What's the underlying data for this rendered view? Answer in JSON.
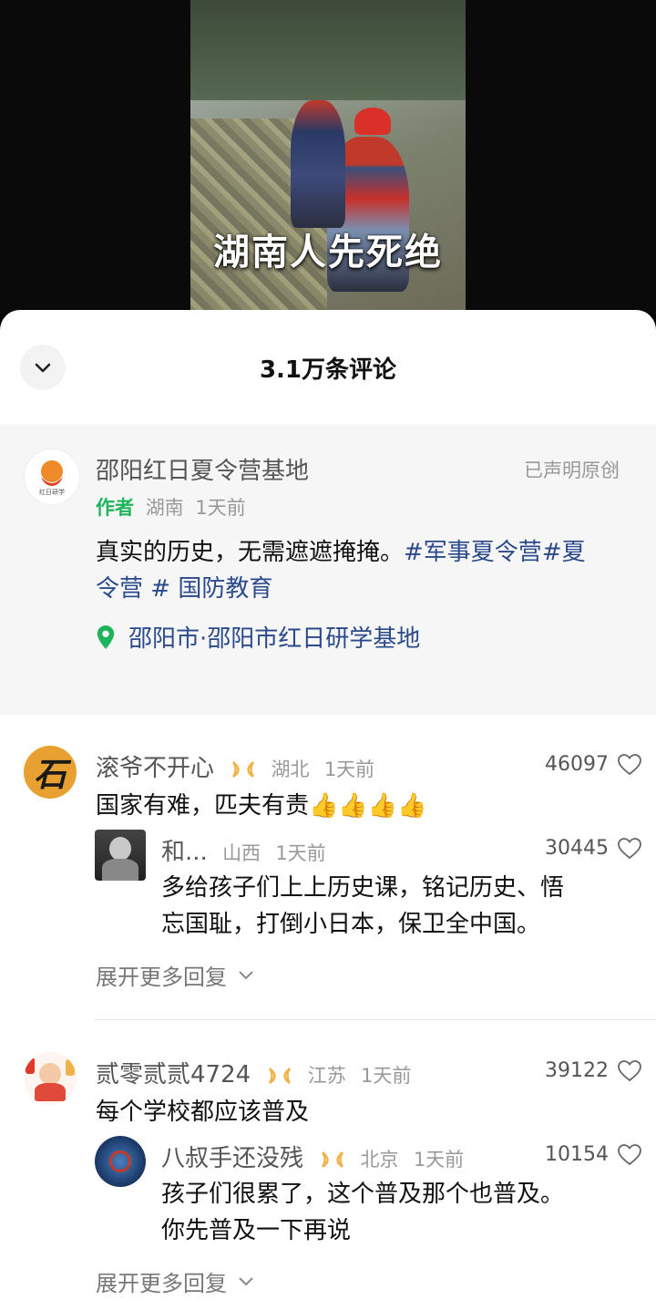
{
  "video": {
    "caption": "湖南人先死绝"
  },
  "sheet": {
    "title": "3.1万条评论"
  },
  "post": {
    "author": "邵阳红日夏令营基地",
    "avatar_text": "红日研学",
    "declare": "已声明原创",
    "author_tag": "作者",
    "region": "湖南",
    "time": "1天前",
    "text": "真实的历史，无需遮遮掩掩。",
    "hashtag1": "#军事夏令营",
    "hashtag2a": "#夏",
    "hashtag2b": "令营",
    "hashtag3": "# 国防教育",
    "location": "邵阳市·邵阳市红日研学基地",
    "location_color": "#1fb35b"
  },
  "comments": [
    {
      "name": "滚爷不开心",
      "avatar_text": "石",
      "region": "湖北",
      "time": "1天前",
      "likes": "46097",
      "text": "国家有难，匹夫有责",
      "emoji": "👍👍👍👍",
      "reply": {
        "name": "和...",
        "region": "山西",
        "time": "1天前",
        "likes": "30445",
        "text_line1": "多给孩子们上上历史课，铭记历史、悟",
        "text_line2": "忘国耻，打倒小日本，保卫全中国。"
      },
      "expand": "展开更多回复"
    },
    {
      "name": "贰零贰贰4724",
      "region": "江苏",
      "time": "1天前",
      "likes": "39122",
      "text": "每个学校都应该普及",
      "reply": {
        "name": "八叔手还没残",
        "region": "北京",
        "time": "1天前",
        "likes": "10154",
        "text_line1": "孩子们很累了，这个普及那个也普及。",
        "text_line2": "你先普及一下再说"
      },
      "expand": "展开更多回复"
    }
  ],
  "colors": {
    "badge": "#f1b24a",
    "hashtag": "#2a4a8c",
    "accent_green": "#1fb35b"
  },
  "icons": [
    "chevron-down-icon",
    "chevron-right-icon",
    "heart-outline-icon",
    "location-pin-icon",
    "fan-badge-icon"
  ]
}
